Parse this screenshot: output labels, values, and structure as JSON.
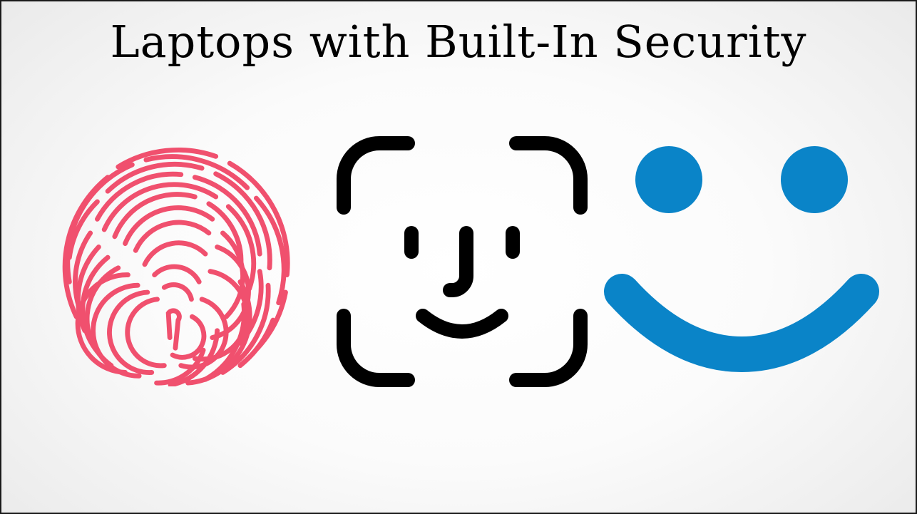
{
  "slide": {
    "title": "Laptops with Built-In Security"
  },
  "icons": [
    {
      "name": "fingerprint-icon",
      "color": "#f0506e"
    },
    {
      "name": "face-id-icon",
      "color": "#000000"
    },
    {
      "name": "windows-hello-icon",
      "color": "#0a84c8"
    }
  ],
  "colors": {
    "fingerprint": "#f0506e",
    "face_id": "#000000",
    "windows_hello": "#0a84c8",
    "border": "#1a1a1a"
  }
}
